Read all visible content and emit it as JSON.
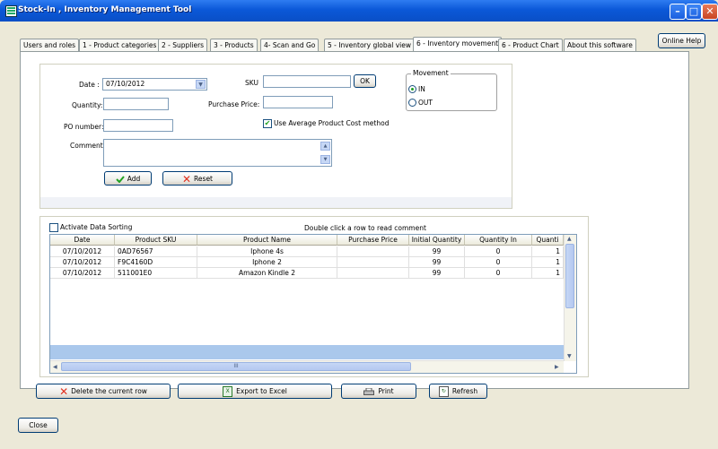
{
  "window": {
    "title": "Stock-In , Inventory Management Tool",
    "min_label": "–",
    "max_label": "□",
    "close_label": "✕"
  },
  "tabs": [
    {
      "label": "Users and roles"
    },
    {
      "label": "1 - Product categories"
    },
    {
      "label": "2 - Suppliers"
    },
    {
      "label": "3 - Products"
    },
    {
      "label": "4- Scan and Go"
    },
    {
      "label": "5 - Inventory global view"
    },
    {
      "label": "6 - Inventory movement"
    },
    {
      "label": "6 - Product Chart"
    },
    {
      "label": "About this software"
    }
  ],
  "active_tab": 6,
  "online_help_label": "Online Help",
  "form": {
    "date_label": "Date :",
    "date_value": "07/10/2012",
    "sku_label": "SKU",
    "sku_value": "",
    "ok_label": "OK",
    "quantity_label": "Quantity:",
    "quantity_value": "",
    "purchase_price_label": "Purchase Price:",
    "purchase_price_value": "",
    "po_label": "PO number:",
    "po_value": "",
    "avg_cost_label": "Use Average Product Cost method",
    "avg_cost_checked": true,
    "comment_label": "Comment",
    "comment_value": "",
    "add_label": "Add",
    "reset_label": "Reset",
    "movement_legend": "Movement",
    "movement_in_label": "IN",
    "movement_out_label": "OUT",
    "movement_selected": "IN"
  },
  "grid": {
    "sorting_label": "Activate Data Sorting",
    "sorting_checked": false,
    "hint": "Double click a row to read comment",
    "columns": [
      "Date",
      "Product SKU",
      "Product Name",
      "Purchase Price",
      "Initial Quantity",
      "Quantity In",
      "Quanti"
    ],
    "rows": [
      [
        "07/10/2012",
        "0AD76567",
        "Iphone 4s",
        "",
        "99",
        "0",
        "1"
      ],
      [
        "07/10/2012",
        "F9C4160D",
        "Iphone 2",
        "",
        "99",
        "0",
        "1"
      ],
      [
        "07/10/2012",
        "511001E0",
        "Amazon Kindle 2",
        "",
        "99",
        "0",
        "1"
      ]
    ],
    "hscroll_grip": "III"
  },
  "actions": {
    "delete_label": "Delete the current row",
    "export_label": "Export to Excel",
    "print_label": "Print",
    "refresh_label": "Refresh"
  },
  "close_label": "Close"
}
